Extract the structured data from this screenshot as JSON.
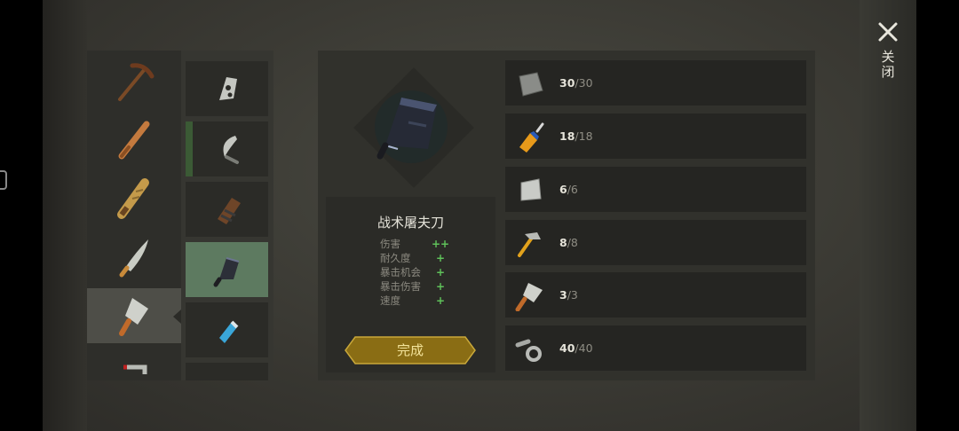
{
  "header": {
    "close_label": "关闭"
  },
  "categories": [
    {
      "icon": "pickaxe-icon",
      "selected": false
    },
    {
      "icon": "baseball-bat-icon",
      "selected": false
    },
    {
      "icon": "wooden-plank-weapon-icon",
      "selected": false
    },
    {
      "icon": "machete-icon",
      "selected": false
    },
    {
      "icon": "cleaver-icon",
      "selected": true
    },
    {
      "icon": "pipe-wrench-icon",
      "selected": false
    }
  ],
  "subitems": [
    {
      "icon": "blade-icon",
      "selected": false
    },
    {
      "icon": "sickle-icon",
      "selected": false,
      "marked": true
    },
    {
      "icon": "wooden-sheath-icon",
      "selected": false
    },
    {
      "icon": "tactical-cleaver-icon",
      "selected": true
    },
    {
      "icon": "blue-canister-icon",
      "selected": false
    },
    {
      "icon": "partial-item-icon",
      "selected": false
    }
  ],
  "detail": {
    "hero_icon": "tactical-cleaver-icon",
    "item_name": "战术屠夫刀",
    "stats": [
      {
        "name": "伤害",
        "value": "++"
      },
      {
        "name": "耐久度",
        "value": "+"
      },
      {
        "name": "暴击机会",
        "value": "+"
      },
      {
        "name": "暴击伤害",
        "value": "+"
      },
      {
        "name": "速度",
        "value": "+"
      }
    ],
    "craft_button_label": "完成"
  },
  "requirements": [
    {
      "icon": "metal-scrap-icon",
      "have": "30",
      "sep": "/",
      "need": "30"
    },
    {
      "icon": "glue-bottle-icon",
      "have": "18",
      "sep": "/",
      "need": "18"
    },
    {
      "icon": "steel-plate-icon",
      "have": "6",
      "sep": "/",
      "need": "6"
    },
    {
      "icon": "hammer-icon",
      "have": "8",
      "sep": "/",
      "need": "8"
    },
    {
      "icon": "cleaver-icon",
      "have": "3",
      "sep": "/",
      "need": "3"
    },
    {
      "icon": "nuts-bolts-icon",
      "have": "40",
      "sep": "/",
      "need": "40"
    }
  ],
  "colors": {
    "accent_gold": "#9a7a1a",
    "stat_green": "#5fc15a",
    "selected_sub": "#5d7a60",
    "marked_bar": "#3b5a35"
  }
}
